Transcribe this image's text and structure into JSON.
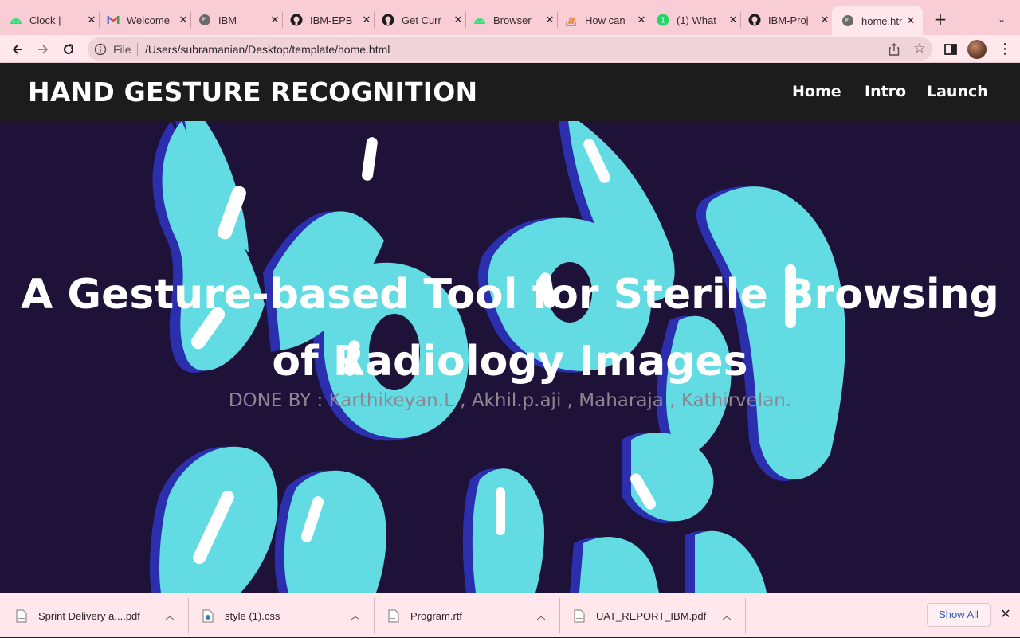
{
  "browser": {
    "tabs": [
      {
        "title": "Clock |",
        "icon": "android-icon"
      },
      {
        "title": "Welcome",
        "icon": "gmail-icon"
      },
      {
        "title": "IBM",
        "icon": "globe-icon"
      },
      {
        "title": "IBM-EPB",
        "icon": "github-icon"
      },
      {
        "title": "Get Curr",
        "icon": "github-icon"
      },
      {
        "title": "Browser",
        "icon": "android-icon"
      },
      {
        "title": "How can",
        "icon": "stackoverflow-icon"
      },
      {
        "title": "(1) What",
        "icon": "whatsapp-icon"
      },
      {
        "title": "IBM-Proj",
        "icon": "github-icon"
      },
      {
        "title": "home.htm",
        "icon": "globe-icon",
        "active": true
      }
    ],
    "address": {
      "scheme_label": "File",
      "url": "/Users/subramanian/Desktop/template/home.html"
    }
  },
  "site": {
    "title": "HAND GESTURE RECOGNITION",
    "nav": [
      "Home",
      "Intro",
      "Launch"
    ],
    "hero_title": "A Gesture-based Tool for Sterile Browsing of Radiology Images",
    "hero_subtitle": "DONE BY : Karthikeyan.L , Akhil.p.aji , Maharaja , Kathirvelan."
  },
  "downloads": {
    "items": [
      "Sprint Delivery a....pdf",
      "style (1).css",
      "Program.rtf",
      "UAT_REPORT_IBM.pdf"
    ],
    "show_all_label": "Show All"
  },
  "colors": {
    "tabbar": "#f8cdd6",
    "header": "#1c1c1c",
    "hero_bg": "#1e1239",
    "lettering": "#62dbe3",
    "lettering_shadow": "#2b2fae"
  }
}
